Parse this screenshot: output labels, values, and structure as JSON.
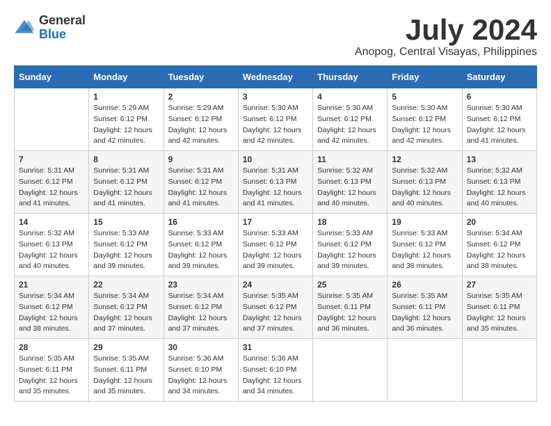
{
  "header": {
    "logo_general": "General",
    "logo_blue": "Blue",
    "month_year": "July 2024",
    "location": "Anopog, Central Visayas, Philippines"
  },
  "days_of_week": [
    "Sunday",
    "Monday",
    "Tuesday",
    "Wednesday",
    "Thursday",
    "Friday",
    "Saturday"
  ],
  "weeks": [
    [
      {
        "day": "",
        "sunrise": "",
        "sunset": "",
        "daylight": ""
      },
      {
        "day": "1",
        "sunrise": "Sunrise: 5:29 AM",
        "sunset": "Sunset: 6:12 PM",
        "daylight": "Daylight: 12 hours and 42 minutes."
      },
      {
        "day": "2",
        "sunrise": "Sunrise: 5:29 AM",
        "sunset": "Sunset: 6:12 PM",
        "daylight": "Daylight: 12 hours and 42 minutes."
      },
      {
        "day": "3",
        "sunrise": "Sunrise: 5:30 AM",
        "sunset": "Sunset: 6:12 PM",
        "daylight": "Daylight: 12 hours and 42 minutes."
      },
      {
        "day": "4",
        "sunrise": "Sunrise: 5:30 AM",
        "sunset": "Sunset: 6:12 PM",
        "daylight": "Daylight: 12 hours and 42 minutes."
      },
      {
        "day": "5",
        "sunrise": "Sunrise: 5:30 AM",
        "sunset": "Sunset: 6:12 PM",
        "daylight": "Daylight: 12 hours and 42 minutes."
      },
      {
        "day": "6",
        "sunrise": "Sunrise: 5:30 AM",
        "sunset": "Sunset: 6:12 PM",
        "daylight": "Daylight: 12 hours and 41 minutes."
      }
    ],
    [
      {
        "day": "7",
        "sunrise": "Sunrise: 5:31 AM",
        "sunset": "Sunset: 6:12 PM",
        "daylight": "Daylight: 12 hours and 41 minutes."
      },
      {
        "day": "8",
        "sunrise": "Sunrise: 5:31 AM",
        "sunset": "Sunset: 6:12 PM",
        "daylight": "Daylight: 12 hours and 41 minutes."
      },
      {
        "day": "9",
        "sunrise": "Sunrise: 5:31 AM",
        "sunset": "Sunset: 6:12 PM",
        "daylight": "Daylight: 12 hours and 41 minutes."
      },
      {
        "day": "10",
        "sunrise": "Sunrise: 5:31 AM",
        "sunset": "Sunset: 6:13 PM",
        "daylight": "Daylight: 12 hours and 41 minutes."
      },
      {
        "day": "11",
        "sunrise": "Sunrise: 5:32 AM",
        "sunset": "Sunset: 6:13 PM",
        "daylight": "Daylight: 12 hours and 40 minutes."
      },
      {
        "day": "12",
        "sunrise": "Sunrise: 5:32 AM",
        "sunset": "Sunset: 6:13 PM",
        "daylight": "Daylight: 12 hours and 40 minutes."
      },
      {
        "day": "13",
        "sunrise": "Sunrise: 5:32 AM",
        "sunset": "Sunset: 6:13 PM",
        "daylight": "Daylight: 12 hours and 40 minutes."
      }
    ],
    [
      {
        "day": "14",
        "sunrise": "Sunrise: 5:32 AM",
        "sunset": "Sunset: 6:13 PM",
        "daylight": "Daylight: 12 hours and 40 minutes."
      },
      {
        "day": "15",
        "sunrise": "Sunrise: 5:33 AM",
        "sunset": "Sunset: 6:12 PM",
        "daylight": "Daylight: 12 hours and 39 minutes."
      },
      {
        "day": "16",
        "sunrise": "Sunrise: 5:33 AM",
        "sunset": "Sunset: 6:12 PM",
        "daylight": "Daylight: 12 hours and 39 minutes."
      },
      {
        "day": "17",
        "sunrise": "Sunrise: 5:33 AM",
        "sunset": "Sunset: 6:12 PM",
        "daylight": "Daylight: 12 hours and 39 minutes."
      },
      {
        "day": "18",
        "sunrise": "Sunrise: 5:33 AM",
        "sunset": "Sunset: 6:12 PM",
        "daylight": "Daylight: 12 hours and 39 minutes."
      },
      {
        "day": "19",
        "sunrise": "Sunrise: 5:33 AM",
        "sunset": "Sunset: 6:12 PM",
        "daylight": "Daylight: 12 hours and 38 minutes."
      },
      {
        "day": "20",
        "sunrise": "Sunrise: 5:34 AM",
        "sunset": "Sunset: 6:12 PM",
        "daylight": "Daylight: 12 hours and 38 minutes."
      }
    ],
    [
      {
        "day": "21",
        "sunrise": "Sunrise: 5:34 AM",
        "sunset": "Sunset: 6:12 PM",
        "daylight": "Daylight: 12 hours and 38 minutes."
      },
      {
        "day": "22",
        "sunrise": "Sunrise: 5:34 AM",
        "sunset": "Sunset: 6:12 PM",
        "daylight": "Daylight: 12 hours and 37 minutes."
      },
      {
        "day": "23",
        "sunrise": "Sunrise: 5:34 AM",
        "sunset": "Sunset: 6:12 PM",
        "daylight": "Daylight: 12 hours and 37 minutes."
      },
      {
        "day": "24",
        "sunrise": "Sunrise: 5:35 AM",
        "sunset": "Sunset: 6:12 PM",
        "daylight": "Daylight: 12 hours and 37 minutes."
      },
      {
        "day": "25",
        "sunrise": "Sunrise: 5:35 AM",
        "sunset": "Sunset: 6:11 PM",
        "daylight": "Daylight: 12 hours and 36 minutes."
      },
      {
        "day": "26",
        "sunrise": "Sunrise: 5:35 AM",
        "sunset": "Sunset: 6:11 PM",
        "daylight": "Daylight: 12 hours and 36 minutes."
      },
      {
        "day": "27",
        "sunrise": "Sunrise: 5:35 AM",
        "sunset": "Sunset: 6:11 PM",
        "daylight": "Daylight: 12 hours and 35 minutes."
      }
    ],
    [
      {
        "day": "28",
        "sunrise": "Sunrise: 5:35 AM",
        "sunset": "Sunset: 6:11 PM",
        "daylight": "Daylight: 12 hours and 35 minutes."
      },
      {
        "day": "29",
        "sunrise": "Sunrise: 5:35 AM",
        "sunset": "Sunset: 6:11 PM",
        "daylight": "Daylight: 12 hours and 35 minutes."
      },
      {
        "day": "30",
        "sunrise": "Sunrise: 5:36 AM",
        "sunset": "Sunset: 6:10 PM",
        "daylight": "Daylight: 12 hours and 34 minutes."
      },
      {
        "day": "31",
        "sunrise": "Sunrise: 5:36 AM",
        "sunset": "Sunset: 6:10 PM",
        "daylight": "Daylight: 12 hours and 34 minutes."
      },
      {
        "day": "",
        "sunrise": "",
        "sunset": "",
        "daylight": ""
      },
      {
        "day": "",
        "sunrise": "",
        "sunset": "",
        "daylight": ""
      },
      {
        "day": "",
        "sunrise": "",
        "sunset": "",
        "daylight": ""
      }
    ]
  ]
}
